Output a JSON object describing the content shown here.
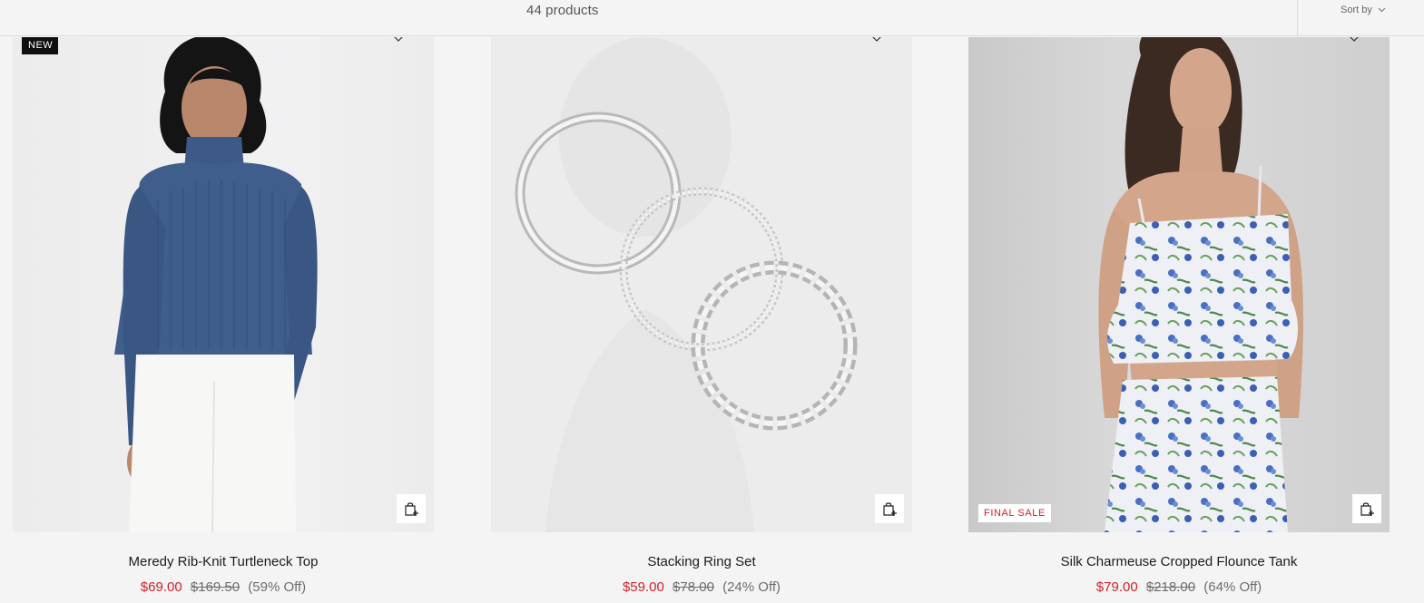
{
  "header": {
    "product_count": "44 products",
    "sort_label": "Sort by"
  },
  "products": [
    {
      "name": "Meredy Rib-Knit Turtleneck Top",
      "badge": "NEW",
      "sale_price": "$69.00",
      "original_price": "$169.50",
      "discount": "(59% Off)",
      "image_subject": "model wearing navy rib-knit turtleneck and white pants"
    },
    {
      "name": "Stacking Ring Set",
      "sale_price": "$59.00",
      "original_price": "$78.00",
      "discount": "(24% Off)",
      "image_subject": "three silver stacking rings"
    },
    {
      "name": "Silk Charmeuse Cropped Flounce Tank",
      "badge": "FINAL SALE",
      "sale_price": "$79.00",
      "original_price": "$218.00",
      "discount": "(64% Off)",
      "image_subject": "model wearing blue and green floral silk flounce tank and matching pants"
    }
  ],
  "colors": {
    "sale_price": "#d2202a",
    "original_price": "#6d6d6d",
    "badge_new_bg": "#0f0f0f",
    "page_bg": "#f4f4f4"
  },
  "icons": {
    "quick_add": "shopping-bag-plus-icon",
    "wishlist": "heart-icon",
    "sort": "chevron-down-icon"
  }
}
